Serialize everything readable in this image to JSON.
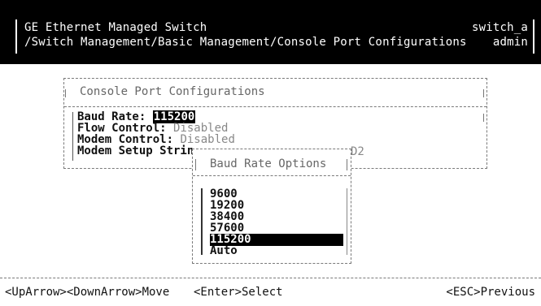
{
  "header": {
    "title": "GE Ethernet Managed Switch",
    "path": "/Switch Management/Basic Management/Console Port Configurations",
    "hostname": "switch_a",
    "user": "admin"
  },
  "section": {
    "title": "Console Port Configurations",
    "fields": [
      {
        "label": "Baud Rate:",
        "value": "115200"
      },
      {
        "label": "Flow Control:",
        "value": "Disabled"
      },
      {
        "label": "Modem Control:",
        "value": "Disabled"
      },
      {
        "label": "Modem Setup Strin",
        "value": ""
      }
    ],
    "trailing_text": "D2"
  },
  "popup": {
    "title": "Baud Rate Options",
    "options": [
      "9600",
      "19200",
      "38400",
      "57600",
      "115200",
      "Auto"
    ],
    "selected": "115200"
  },
  "footer": {
    "move": "<UpArrow><DownArrow>Move",
    "select": "<Enter>Select",
    "previous": "<ESC>Previous"
  }
}
